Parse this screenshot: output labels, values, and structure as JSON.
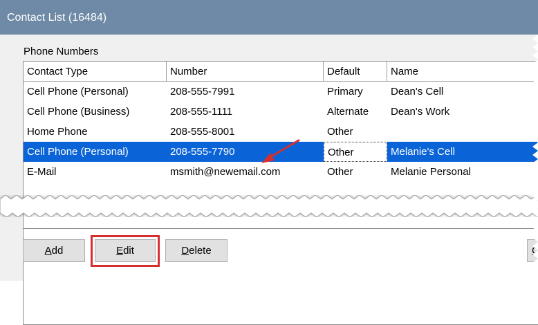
{
  "window": {
    "title": "Contact List (16484)"
  },
  "group_label": "Phone Numbers",
  "table": {
    "columns": [
      "Contact Type",
      "Number",
      "Default",
      "Name"
    ],
    "rows": [
      {
        "type": "Cell Phone (Personal)",
        "number": "208-555-7991",
        "default": "Primary",
        "name": "Dean's Cell"
      },
      {
        "type": "Cell Phone (Business)",
        "number": "208-555-1111",
        "default": "Alternate",
        "name": "Dean's Work"
      },
      {
        "type": "Home Phone",
        "number": "208-555-8001",
        "default": "Other",
        "name": ""
      },
      {
        "type": "Cell Phone (Personal)",
        "number": "208-555-7790",
        "default": "Other",
        "name": "Melanie's Cell",
        "selected": true
      },
      {
        "type": "E-Mail",
        "number": "msmith@newemail.com",
        "default": "Other",
        "name": "Melanie Personal"
      }
    ]
  },
  "buttons": {
    "add": {
      "label_mnemonic": "A",
      "label_rest": "dd"
    },
    "edit": {
      "label_mnemonic": "E",
      "label_rest": "dit",
      "highlighted": true
    },
    "delete": {
      "label_mnemonic": "D",
      "label_rest": "elete"
    },
    "cut_off": {
      "label_mnemonic": "C"
    }
  },
  "colors": {
    "titlebar": "#6e8aa6",
    "selection": "#0a64d8",
    "highlight_box": "#d32f2f",
    "arrow": "#d32f2f"
  },
  "icons": [
    "red-arrow-icon"
  ]
}
